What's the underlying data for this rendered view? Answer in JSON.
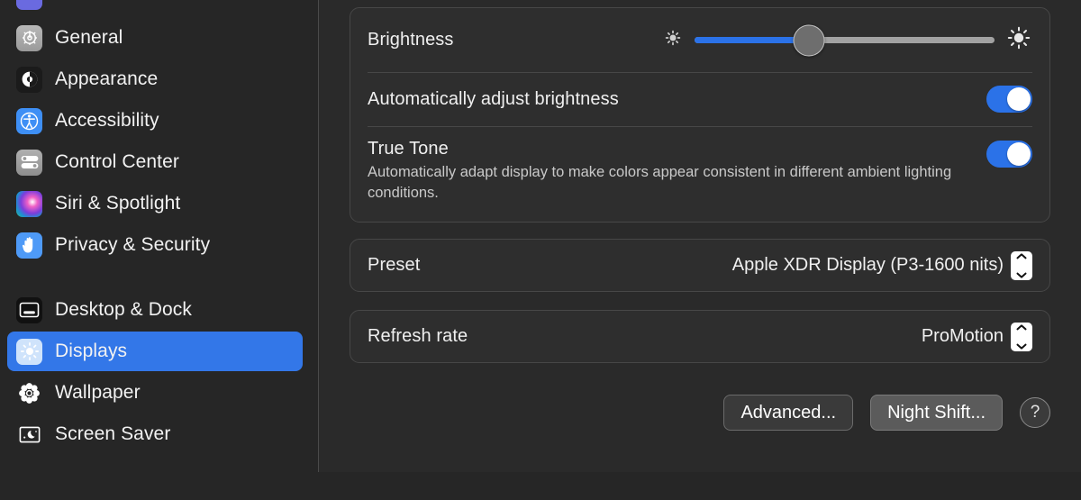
{
  "window": {
    "section_title": "Displays"
  },
  "sidebar": {
    "items": [
      {
        "label": "",
        "icon": "focus-icon",
        "selected": false,
        "partial": true
      },
      {
        "label": "General",
        "icon": "gear-icon",
        "selected": false
      },
      {
        "label": "Appearance",
        "icon": "appearance-icon",
        "selected": false
      },
      {
        "label": "Accessibility",
        "icon": "accessibility-icon",
        "selected": false
      },
      {
        "label": "Control Center",
        "icon": "control-center-icon",
        "selected": false
      },
      {
        "label": "Siri & Spotlight",
        "icon": "siri-icon",
        "selected": false
      },
      {
        "label": "Privacy & Security",
        "icon": "privacy-hand-icon",
        "selected": false
      },
      {
        "label": "Desktop & Dock",
        "icon": "desktop-dock-icon",
        "selected": false
      },
      {
        "label": "Displays",
        "icon": "displays-sun-icon",
        "selected": true
      },
      {
        "label": "Wallpaper",
        "icon": "wallpaper-flower-icon",
        "selected": false
      },
      {
        "label": "Screen Saver",
        "icon": "screen-saver-icon",
        "selected": false
      }
    ]
  },
  "main": {
    "brightness": {
      "label": "Brightness",
      "value_percent": 38,
      "min_icon": "sun-small-icon",
      "max_icon": "sun-large-icon"
    },
    "auto_brightness": {
      "label": "Automatically adjust brightness",
      "state": "on"
    },
    "true_tone": {
      "label": "True Tone",
      "description": "Automatically adapt display to make colors appear consistent in different ambient lighting conditions.",
      "state": "on"
    },
    "preset": {
      "label": "Preset",
      "value": "Apple XDR Display (P3-1600 nits)"
    },
    "refresh_rate": {
      "label": "Refresh rate",
      "value": "ProMotion"
    },
    "buttons": {
      "advanced": "Advanced...",
      "night_shift": "Night Shift...",
      "help": "?"
    }
  },
  "annotation": {
    "target": "Night Shift...",
    "shape": "hand-drawn-oval",
    "color": "#b72416"
  },
  "colors": {
    "accent_blue": "#2b72e8",
    "selection_blue": "#3377e8",
    "panel_bg": "#2a2a2a",
    "sidebar_bg": "#262626",
    "card_bg": "#2e2e2e",
    "card_border": "#474747",
    "text_primary": "#f0f0f0",
    "text_secondary": "#c9c9c9",
    "annotation_red": "#b72416"
  }
}
